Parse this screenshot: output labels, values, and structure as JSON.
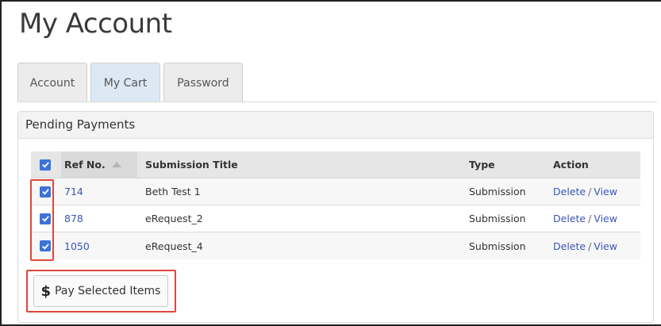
{
  "page": {
    "title": "My Account"
  },
  "tabs": [
    {
      "label": "Account",
      "active": false
    },
    {
      "label": "My Cart",
      "active": true
    },
    {
      "label": "Password",
      "active": false
    }
  ],
  "panel": {
    "title": "Pending Payments"
  },
  "table": {
    "columns": [
      "Ref No.",
      "Submission Title",
      "Type",
      "Action"
    ],
    "header_checkbox": true,
    "rows": [
      {
        "checked": true,
        "ref": "714",
        "title": "Beth Test 1",
        "type": "Submission",
        "delete": "Delete",
        "sep": "/",
        "view": "View"
      },
      {
        "checked": true,
        "ref": "878",
        "title": "eRequest_2",
        "type": "Submission",
        "delete": "Delete",
        "sep": "/",
        "view": "View"
      },
      {
        "checked": true,
        "ref": "1050",
        "title": "eRequest_4",
        "type": "Submission",
        "delete": "Delete",
        "sep": "/",
        "view": "View"
      }
    ]
  },
  "pay_button": {
    "icon": "$",
    "label": "Pay Selected Items"
  },
  "colors": {
    "link": "#3b56b8",
    "checkbox": "#3b73d6",
    "highlight": "#e0463c"
  }
}
